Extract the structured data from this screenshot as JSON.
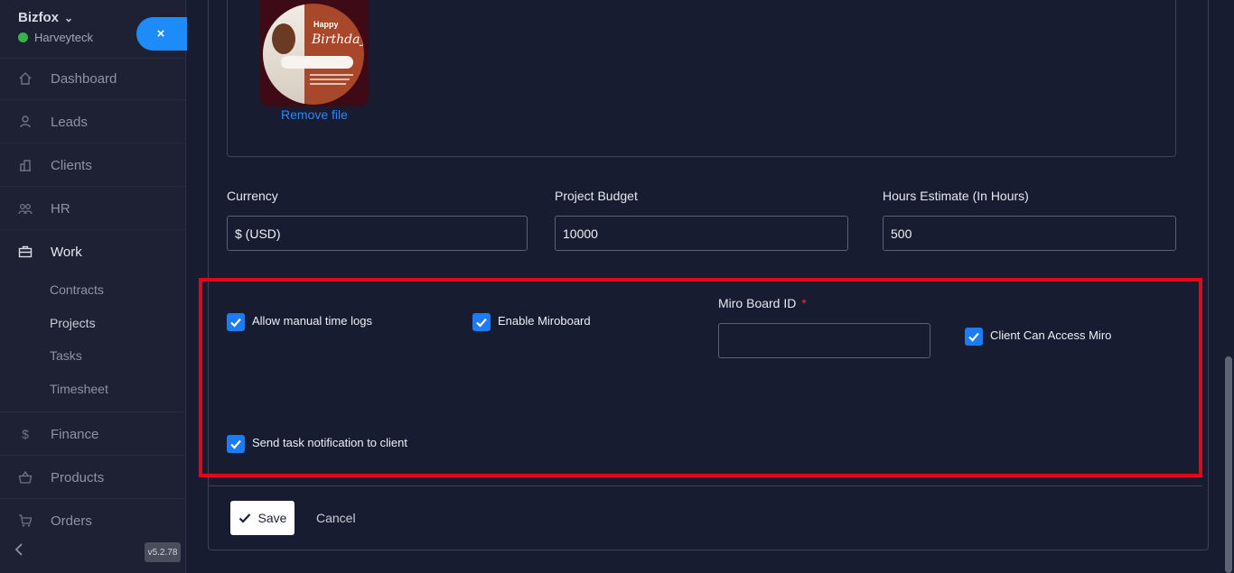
{
  "sidebar": {
    "brand": "Bizfox",
    "org": "Harveyteck",
    "close_icon": "×",
    "items": [
      {
        "label": "Dashboard",
        "icon": "home-icon"
      },
      {
        "label": "Leads",
        "icon": "user-icon"
      },
      {
        "label": "Clients",
        "icon": "building-icon"
      },
      {
        "label": "HR",
        "icon": "users-icon"
      },
      {
        "label": "Work",
        "icon": "briefcase-icon"
      },
      {
        "label": "Finance",
        "icon": "dollar-icon"
      },
      {
        "label": "Products",
        "icon": "basket-icon"
      },
      {
        "label": "Orders",
        "icon": "cart-icon"
      }
    ],
    "work_sub": [
      "Contracts",
      "Projects",
      "Tasks",
      "Timesheet"
    ],
    "version": "v5.2.78"
  },
  "form": {
    "remove_file": "Remove file",
    "currency": {
      "label": "Currency",
      "value": "$ (USD)"
    },
    "budget": {
      "label": "Project Budget",
      "value": "10000"
    },
    "hours": {
      "label": "Hours Estimate (In Hours)",
      "value": "500"
    },
    "allow_manual": "Allow manual time logs",
    "enable_miro": "Enable Miroboard",
    "miro_id_label": "Miro Board ID",
    "miro_required": "*",
    "miro_id_value": "",
    "client_access_miro": "Client Can Access Miro",
    "send_notification": "Send task notification to client",
    "save": "Save",
    "cancel": "Cancel"
  },
  "thumbnail": {
    "title": "Happy",
    "script": "Birthday"
  },
  "colors": {
    "accent": "#1d7cf5",
    "highlight": "#e3051a",
    "link": "#2f86ff"
  }
}
